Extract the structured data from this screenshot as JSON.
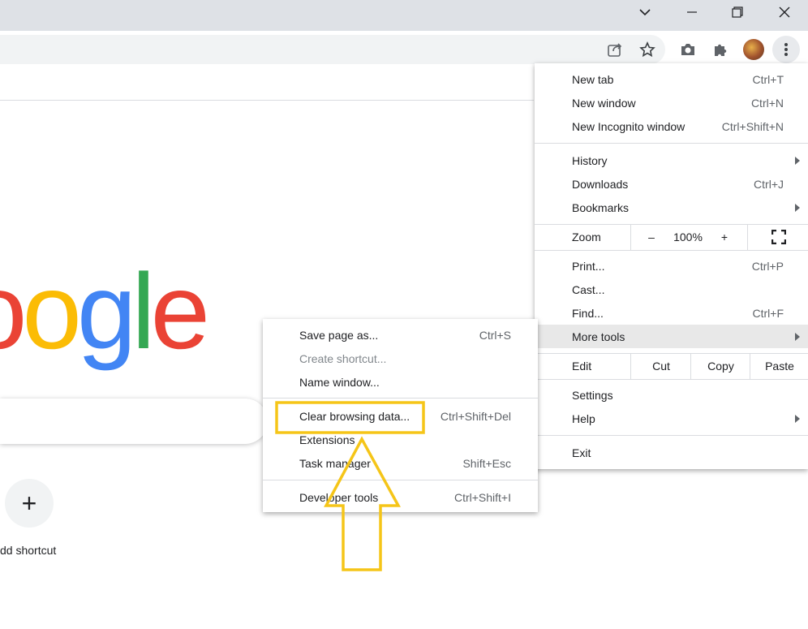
{
  "window_controls": {
    "minimize": "minimize-icon",
    "maximize": "restore-icon",
    "close": "close-icon",
    "tabsearch": "chevron-down-icon"
  },
  "toolbar_icons": [
    "share-icon",
    "star-icon",
    "camera-icon",
    "puzzle-icon",
    "avatar",
    "kebab-menu-icon"
  ],
  "ntp": {
    "logo_letters": [
      {
        "ch": "o",
        "color": "#ea4335"
      },
      {
        "ch": "o",
        "color": "#fbbc05"
      },
      {
        "ch": "g",
        "color": "#4285f4"
      },
      {
        "ch": "l",
        "color": "#34a853"
      },
      {
        "ch": "e",
        "color": "#ea4335"
      }
    ],
    "add_shortcut_label": "dd shortcut",
    "add_shortcut_glyph": "+"
  },
  "main_menu": {
    "group1": [
      {
        "label": "New tab",
        "accel": "Ctrl+T"
      },
      {
        "label": "New window",
        "accel": "Ctrl+N"
      },
      {
        "label": "New Incognito window",
        "accel": "Ctrl+Shift+N"
      }
    ],
    "group2": [
      {
        "label": "History",
        "accel": ""
      },
      {
        "label": "Downloads",
        "accel": "Ctrl+J"
      },
      {
        "label": "Bookmarks",
        "accel": ""
      }
    ],
    "zoom": {
      "label": "Zoom",
      "minus": "–",
      "value": "100%",
      "plus": "+"
    },
    "group3": [
      {
        "label": "Print...",
        "accel": "Ctrl+P"
      },
      {
        "label": "Cast...",
        "accel": ""
      },
      {
        "label": "Find...",
        "accel": "Ctrl+F"
      },
      {
        "label": "More tools",
        "accel": ""
      }
    ],
    "edit": {
      "label": "Edit",
      "cut": "Cut",
      "copy": "Copy",
      "paste": "Paste"
    },
    "group4": [
      {
        "label": "Settings",
        "accel": ""
      },
      {
        "label": "Help",
        "accel": ""
      }
    ],
    "exit": {
      "label": "Exit"
    }
  },
  "more_tools_menu": {
    "group1": [
      {
        "label": "Save page as...",
        "accel": "Ctrl+S"
      },
      {
        "label": "Create shortcut...",
        "accel": ""
      },
      {
        "label": "Name window...",
        "accel": ""
      }
    ],
    "group2": [
      {
        "label": "Clear browsing data...",
        "accel": "Ctrl+Shift+Del"
      },
      {
        "label": "Extensions",
        "accel": ""
      },
      {
        "label": "Task manager",
        "accel": "Shift+Esc"
      }
    ],
    "group3": [
      {
        "label": "Developer tools",
        "accel": "Ctrl+Shift+I"
      }
    ]
  },
  "annotation": {
    "highlight_color": "#f5c518"
  }
}
